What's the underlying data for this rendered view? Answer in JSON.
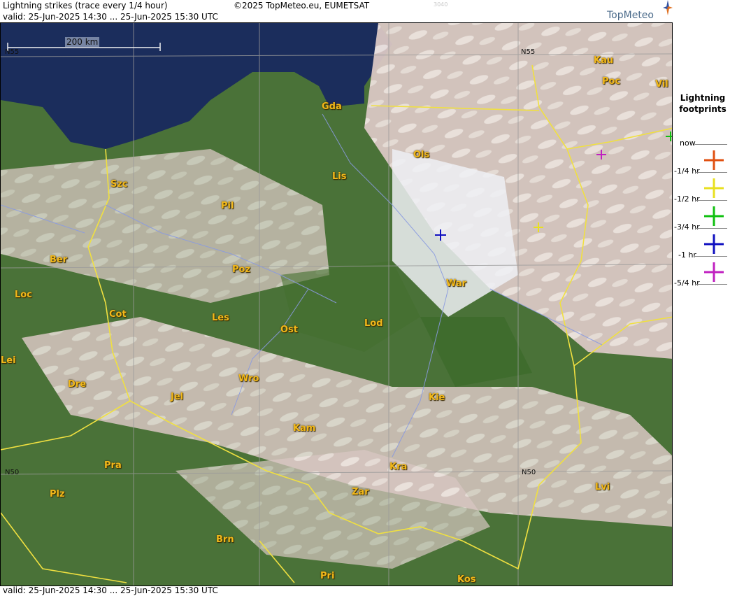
{
  "header": {
    "title": "Lightning strikes (trace every 1/4 hour)",
    "copyright": "©2025 TopMeteo.eu, EUMETSAT",
    "counter": "3040",
    "valid_top": "valid:  25-Jun-2025 14:30 ... 25-Jun-2025 15:30 UTC",
    "valid_bottom": "valid:  25-Jun-2025 14:30 ... 25-Jun-2025 15:30 UTC",
    "logo": "TopMeteo"
  },
  "map": {
    "scale_label": "200 km",
    "lat_labels": [
      "N55",
      "N55",
      "N50",
      "N50"
    ],
    "cities": [
      "Gda",
      "Kau",
      "Poc",
      "Vil",
      "Ols",
      "Szc",
      "Lis",
      "Pil",
      "Ber",
      "Poz",
      "War",
      "Loc",
      "Cot",
      "Les",
      "Ost",
      "Lod",
      "Lei",
      "Dre",
      "Wro",
      "Jel",
      "Kie",
      "Kam",
      "Pra",
      "Kra",
      "Lvi",
      "Plz",
      "Zar",
      "Brn",
      "Pri",
      "Kos"
    ],
    "colors": {
      "sea": "#1b2d5c",
      "land": "#3f6b32",
      "cloud": "#e6d6d2",
      "border": "#f0e040",
      "river": "#8a9ae0"
    },
    "strikes": [
      {
        "period": "-1 hr",
        "color": "#1010c0"
      },
      {
        "period": "-1/2 hr",
        "color": "#e8e020"
      },
      {
        "period": "-5/4 hr",
        "color": "#c020c0"
      },
      {
        "period": "-3/4 hr",
        "color": "#10c010"
      }
    ]
  },
  "legend": {
    "title": "Lightning footprints",
    "rows": [
      {
        "label": "now",
        "color": ""
      },
      {
        "label": "-1/4 hr",
        "color": "#e05010"
      },
      {
        "label": "-1/2 hr",
        "color": "#e8e020"
      },
      {
        "label": "-3/4 hr",
        "color": "#10c010"
      },
      {
        "label": "-1 hr",
        "color": "#1010c0"
      },
      {
        "label": "-5/4 hr",
        "color": "#c020c0"
      }
    ]
  }
}
